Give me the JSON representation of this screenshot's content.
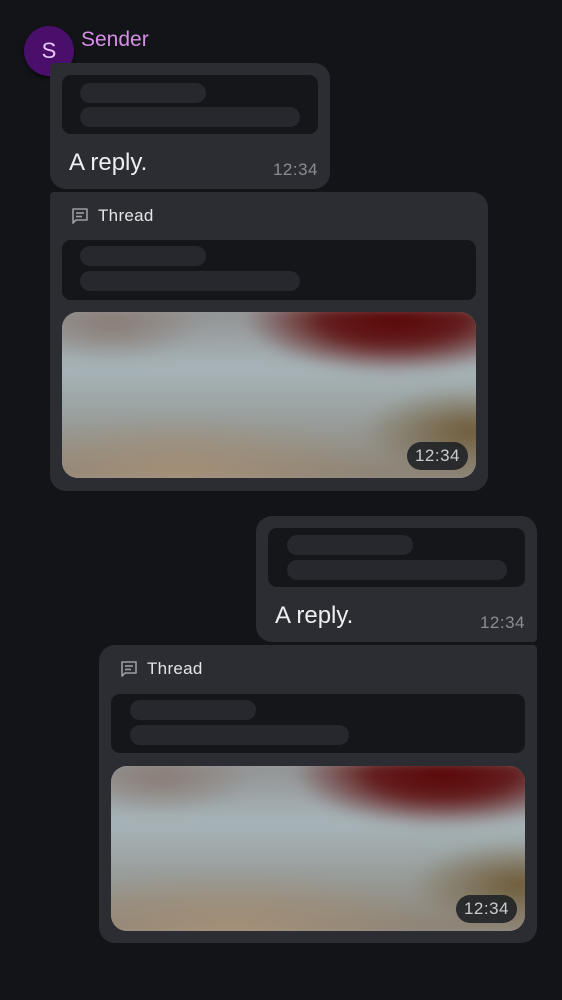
{
  "sender": {
    "name": "Sender",
    "initial": "S"
  },
  "messages": {
    "incoming_reply": {
      "text": "A reply.",
      "time": "12:34"
    },
    "incoming_thread": {
      "label": "Thread",
      "time": "12:34"
    },
    "outgoing_reply": {
      "text": "A reply.",
      "time": "12:34"
    },
    "outgoing_thread": {
      "label": "Thread",
      "time": "12:34"
    }
  }
}
